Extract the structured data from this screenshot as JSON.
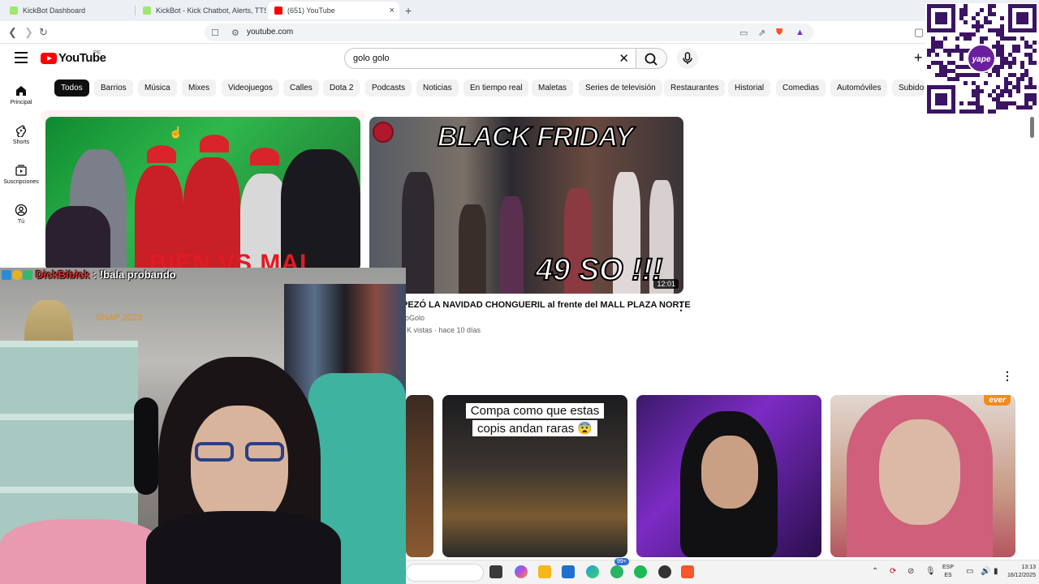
{
  "browser": {
    "tabs": [
      {
        "label": "KickBot Dashboard",
        "favicon_color": "#9fe870"
      },
      {
        "label": "KickBot - Kick Chatbot, Alerts, TTS, C",
        "favicon_color": "#9fe870"
      },
      {
        "label": "(651) YouTube",
        "favicon_color": "#ff0000"
      }
    ],
    "new_tab_label": "+",
    "close_label": "×",
    "url": "youtube.com"
  },
  "youtube": {
    "logo_text": "YouTube",
    "country_code": "PE",
    "search": {
      "value": "golo golo",
      "clear_label": "✕"
    },
    "create_label": "+",
    "sidebar": [
      {
        "label": "Principal",
        "icon": "home-icon"
      },
      {
        "label": "Shorts",
        "icon": "shorts-icon"
      },
      {
        "label": "Suscripciones",
        "icon": "subscriptions-icon"
      },
      {
        "label": "Tú",
        "icon": "you-icon"
      }
    ],
    "chips": [
      "Todos",
      "Barrios",
      "Música",
      "Mixes",
      "Videojuegos",
      "Calles",
      "Dota 2",
      "Podcasts",
      "Noticias",
      "En tiempo real",
      "Maletas",
      "Series de televisión",
      "Restaurantes",
      "Historial",
      "Comedias",
      "Automóviles",
      "Subidos"
    ],
    "active_chip": "Todos",
    "thumb1_overlay_text": "BIEN VS MAL",
    "thumb2": {
      "overlay_top": "BLACK FRIDAY",
      "overlay_bottom": "49 SO !!!",
      "duration": "12:01"
    },
    "video": {
      "title": "IPEZÓ LA NAVIDAD CHONGUERIL al frente del MALL PLAZA NORTE",
      "channel": "oGolo",
      "meta": "K vistas · hace 10 días"
    },
    "more_label": "⋮",
    "shorts": [
      {
        "caption_lines": []
      },
      {
        "caption_lines": [
          "Compa como que estas",
          "copis andan raras 😨"
        ]
      },
      {
        "caption_lines": []
      },
      {
        "caption_lines": [],
        "tag": "ever"
      }
    ]
  },
  "overlay": {
    "chat_user": "DickBibick",
    "chat_message": "!bala probando",
    "qr_logo_text": "yape",
    "cam_sticker_text": "SNAP 2023"
  },
  "taskbar": {
    "notification_badge": "99+",
    "lang_top": "ESP",
    "lang_bottom": "ES",
    "time": "13:13",
    "date": "16/12/2025"
  }
}
